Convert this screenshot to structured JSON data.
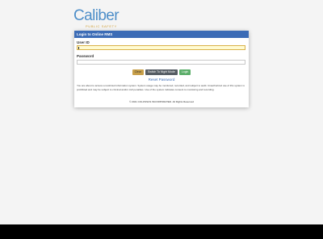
{
  "brand": {
    "name": "Caliber",
    "tagline": "PUBLIC SAFETY"
  },
  "login": {
    "header": "Login to Online RMS",
    "user_id_label": "User ID",
    "password_label": "Password",
    "buttons": {
      "clear": "Clear",
      "night_mode": "Switch To Night Mode",
      "login": "Login"
    },
    "reset_password": "Reset Password",
    "notice": "You are about to access a restricted information system. System usage may be monitored, recorded, and subject to audit. Unauthorized use of this system is prohibited and may be subject to criminal and/or civil penalties. Use of the system indicates consent to monitoring and recording.",
    "copyright": "© 2021 COLOSSUS INCORPORATED. All Rights Reserved"
  },
  "colors": {
    "accent": "#3c6cb6",
    "logo_blue": "#4f8fc9",
    "logo_gold": "#d0a23c",
    "clear_button": "#c8a04a",
    "night_button": "#555c63",
    "login_button": "#5cae6a",
    "active_field": "#fffbd1"
  }
}
